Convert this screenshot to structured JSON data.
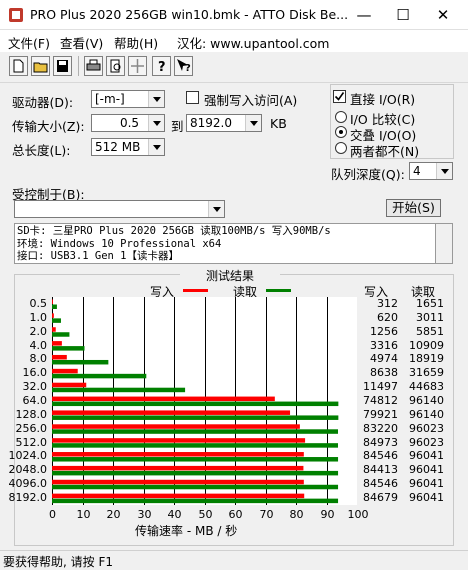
{
  "window": {
    "title": "PRO Plus 2020 256GB win10.bmk - ATTO Disk Be..."
  },
  "menu": {
    "file": "文件(F)",
    "view": "查看(V)",
    "help": "帮助(H)",
    "localization": "汉化: www.upantool.com"
  },
  "settings": {
    "drive_label": "驱动器(D):",
    "drive_value": "[-m-]",
    "force_write_label": "强制写入访问(A)",
    "transfer_size_label": "传输大小(Z):",
    "transfer_from": "0.5",
    "transfer_to_label": "到",
    "transfer_to": "8192.0",
    "transfer_unit": "KB",
    "total_length_label": "总长度(L):",
    "total_length_value": "512 MB",
    "direct_io_label": "直接 I/O(R)",
    "io_compare_label": "I/O 比较(C)",
    "overlapped_io_label": "交叠 I/O(O)",
    "neither_label": "两者都不(N)",
    "queue_depth_label": "队列深度(Q):",
    "queue_depth_value": "4",
    "controlled_by_label": "受控制于(B):",
    "start_button": "开始(S)"
  },
  "description": [
    "SD卡: 三星PRO Plus 2020 256GB 读取100MB/s 写入90MB/s",
    "环境: Windows 10 Professional x64",
    "接口: USB3.1 Gen 1【读卡器】"
  ],
  "results": {
    "title": "测试结果",
    "write_legend": "写入",
    "read_legend": "读取",
    "write_col_header": "写入",
    "read_col_header": "读取",
    "xlabel": "传输速率 - MB / 秒"
  },
  "colors": {
    "write": "#ff0000",
    "read": "#008000"
  },
  "chart_data": {
    "type": "bar",
    "orientation": "horizontal",
    "categories": [
      "0.5",
      "1.0",
      "2.0",
      "4.0",
      "8.0",
      "16.0",
      "32.0",
      "64.0",
      "128.0",
      "256.0",
      "512.0",
      "1024.0",
      "2048.0",
      "4096.0",
      "8192.0"
    ],
    "series": [
      {
        "name": "写入",
        "values": [
          312,
          620,
          1256,
          3316,
          4974,
          8638,
          11497,
          74812,
          79921,
          83220,
          84973,
          84546,
          84413,
          84546,
          84679
        ]
      },
      {
        "name": "读取",
        "values": [
          1651,
          3011,
          5851,
          10909,
          18919,
          31659,
          44683,
          96140,
          96140,
          96023,
          96023,
          96041,
          96041,
          96041,
          96041
        ]
      }
    ],
    "bar_scale_unit": "KB/s",
    "xlabel": "传输速率 - MB / 秒",
    "xticks": [
      "0",
      "10",
      "20",
      "30",
      "40",
      "50",
      "60",
      "70",
      "80",
      "90",
      "100"
    ],
    "xlim": [
      0,
      100
    ],
    "grid": true,
    "legend_position": "top"
  },
  "status": {
    "text": "要获得帮助, 请按 F1"
  }
}
